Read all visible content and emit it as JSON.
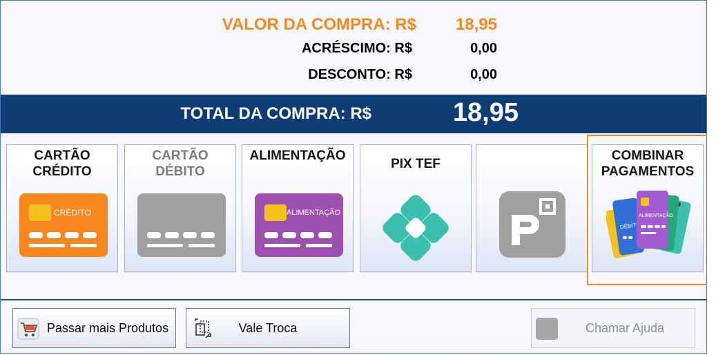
{
  "summary": {
    "valor_label": "VALOR DA COMPRA: R$",
    "valor_value": "18,95",
    "acrescimo_label": "ACRÉSCIMO: R$",
    "acrescimo_value": "0,00",
    "desconto_label": "DESCONTO: R$",
    "desconto_value": "0,00"
  },
  "total": {
    "label": "TOTAL DA COMPRA: R$",
    "value": "18,95"
  },
  "payment_methods": [
    {
      "label": "CARTÃO\nCRÉDITO",
      "card_text": "CRÉDITO",
      "enabled": true,
      "icon": "credit-card-icon"
    },
    {
      "label": "CARTÃO\nDÉBITO",
      "enabled": false,
      "icon": "debit-card-icon"
    },
    {
      "label": "ALIMENTAÇÃO",
      "card_text": "ALIMENTAÇÃO",
      "enabled": true,
      "icon": "meal-card-icon"
    },
    {
      "label": "PIX TEF",
      "enabled": true,
      "icon": "pix-icon"
    },
    {
      "label": "",
      "enabled": true,
      "icon": "picpay-icon"
    },
    {
      "label": "COMBINAR\nPAGAMENTOS",
      "enabled": true,
      "selected": true,
      "icon": "combined-cards-icon",
      "card_texts": [
        "DÉBITO",
        "ALIMENTAÇÃO"
      ]
    }
  ],
  "buttons": {
    "more_products": "Passar mais Produtos",
    "vale_troca": "Vale Troca",
    "help": "Chamar Ajuda"
  },
  "colors": {
    "accent_orange": "#f7871f",
    "total_bar": "#0e3c74",
    "credit_card": "#f7871f",
    "debit_card": "#a0a0a0",
    "meal_card": "#9c4fae",
    "pix": "#3cbfae",
    "picpay": "#a0a0a0",
    "selection_border": "#f08c2c"
  }
}
